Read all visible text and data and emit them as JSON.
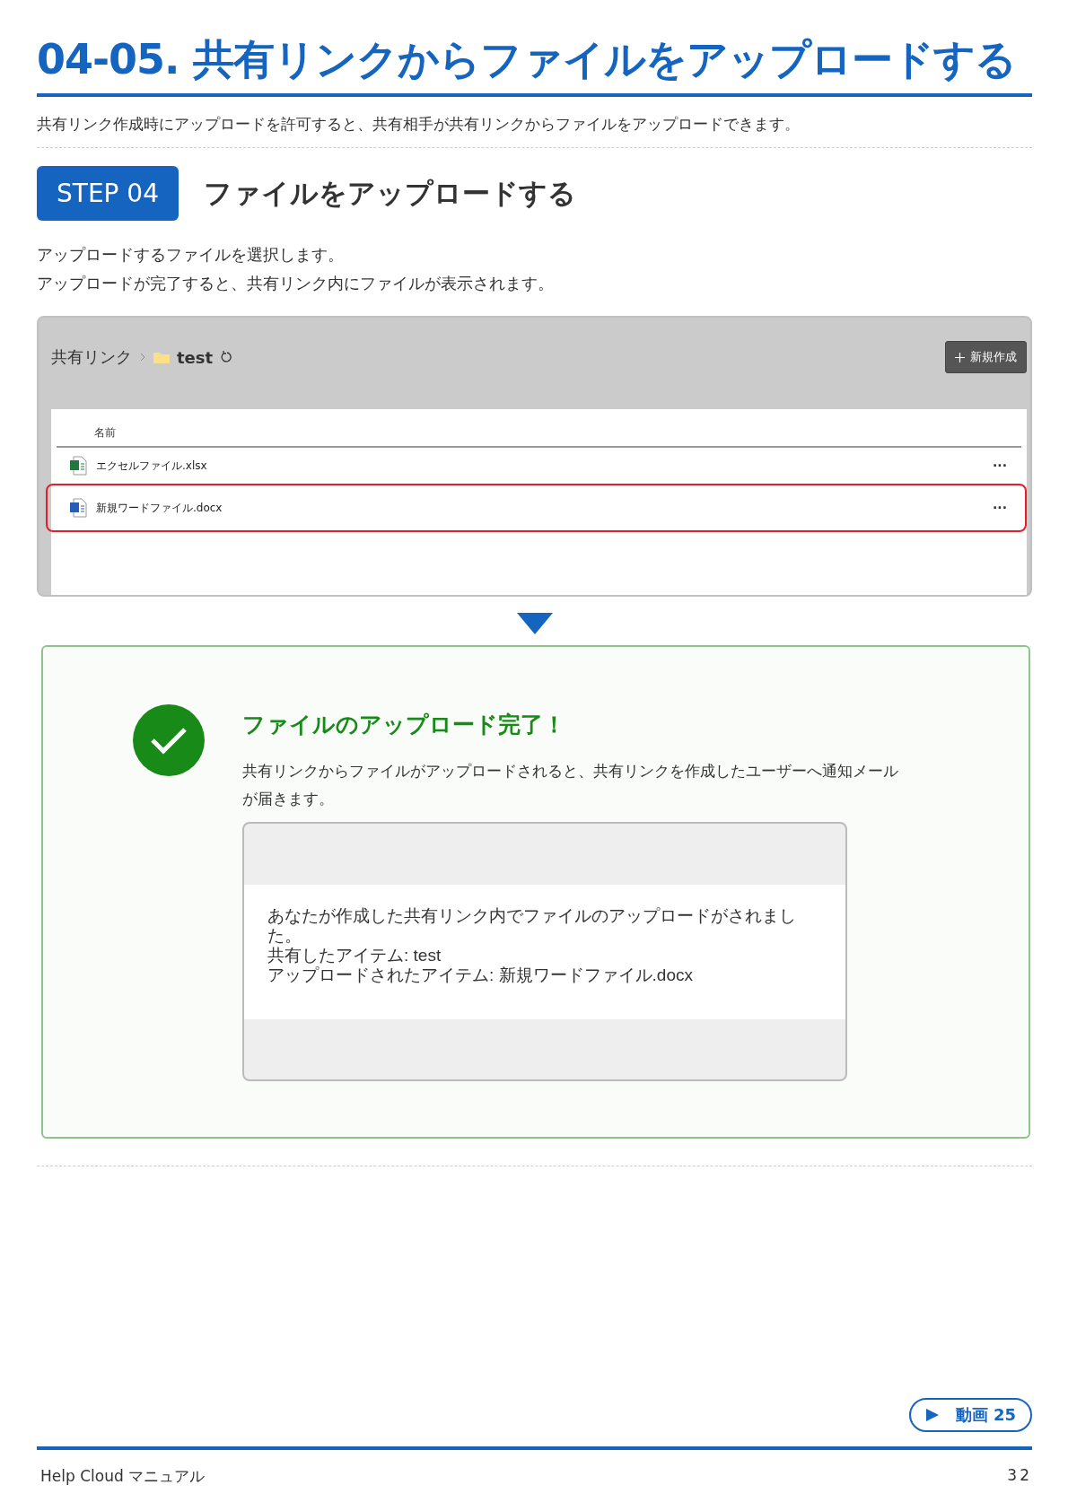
{
  "title": "04-05. 共有リンクからファイルをアップロードする",
  "intro": "共有リンク作成時にアップロードを許可すると、共有相手が共有リンクからファイルをアップロードできます。",
  "step": {
    "badge": "STEP 04",
    "heading": "ファイルをアップロードする",
    "lines": [
      "アップロードするファイルを選択します。",
      "アップロードが完了すると、共有リンク内にファイルが表示されます。"
    ]
  },
  "screenshot": {
    "breadcrumb": [
      "共有リンク",
      "test"
    ],
    "new_button": "新規作成",
    "column": "名前",
    "files": [
      {
        "kind": "excel",
        "name": "エクセルファイル.xlsx",
        "highlighted": false,
        "more": "···"
      },
      {
        "kind": "word",
        "name": "新規ワードファイル.docx",
        "highlighted": true,
        "more": "···"
      }
    ]
  },
  "result": {
    "heading": "ファイルのアップロード完了！",
    "text": "共有リンクからファイルがアップロードされると、共有リンクを作成したユーザーへ通知メールが届きます。",
    "email": [
      "あなたが作成した共有リンク内でファイルのアップロードがされました。",
      "共有したアイテム: test",
      "アップロードされたアイテム: 新規ワードファイル.docx"
    ]
  },
  "video_button": "動画 25",
  "footer": {
    "manual": "Help Cloud マニュアル",
    "page": "32"
  }
}
